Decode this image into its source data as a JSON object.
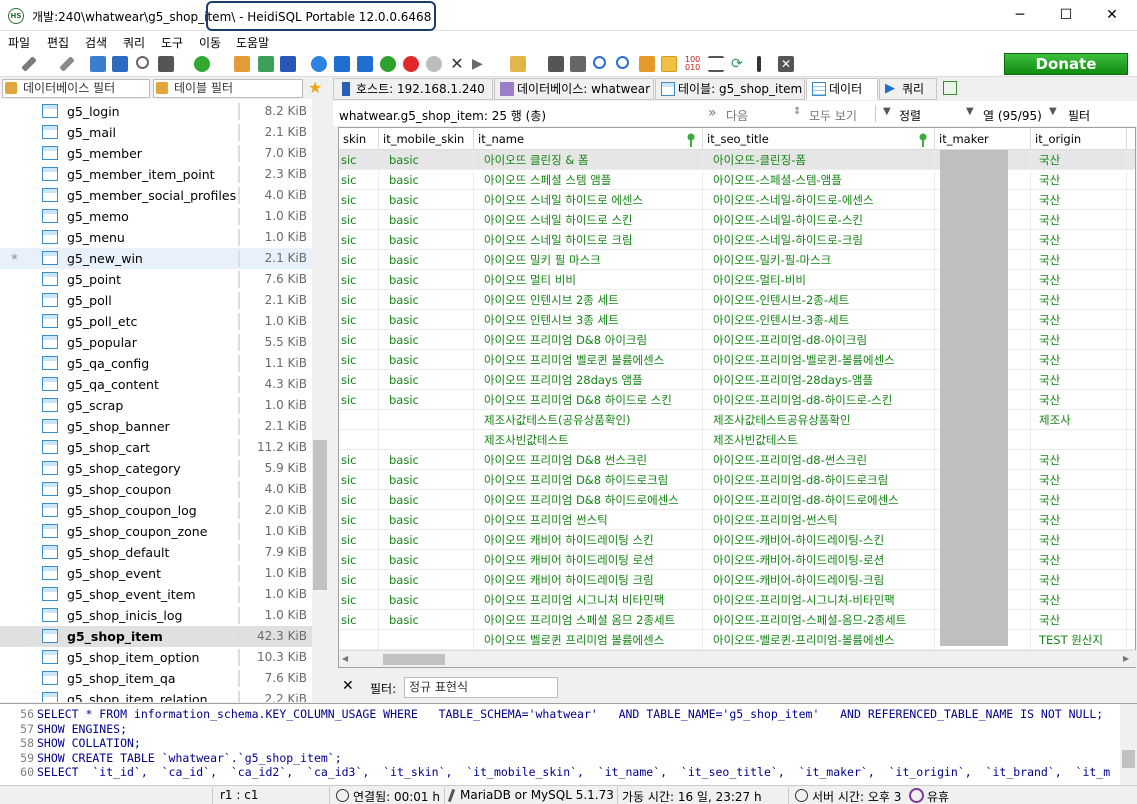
{
  "window": {
    "title": "개발:240\\whatwear\\g5_shop_item\\ - HeidiSQL Portable 12.0.0.6468",
    "icon_text": "HS"
  },
  "menu": [
    "파일",
    "편집",
    "검색",
    "쿼리",
    "도구",
    "이동",
    "도움말"
  ],
  "toolbar": {
    "donate": "Donate"
  },
  "filters": {
    "database_placeholder": "데이터베이스 필터",
    "table_placeholder": "테이블 필터"
  },
  "tree": [
    {
      "name": "g5_login",
      "size": "8.2 KiB"
    },
    {
      "name": "g5_mail",
      "size": "2.1 KiB"
    },
    {
      "name": "g5_member",
      "size": "7.0 KiB"
    },
    {
      "name": "g5_member_item_point",
      "size": "2.3 KiB"
    },
    {
      "name": "g5_member_social_profiles",
      "size": "4.0 KiB"
    },
    {
      "name": "g5_memo",
      "size": "1.0 KiB"
    },
    {
      "name": "g5_menu",
      "size": "1.0 KiB"
    },
    {
      "name": "g5_new_win",
      "size": "2.1 KiB"
    },
    {
      "name": "g5_point",
      "size": "7.6 KiB"
    },
    {
      "name": "g5_poll",
      "size": "2.1 KiB"
    },
    {
      "name": "g5_poll_etc",
      "size": "1.0 KiB"
    },
    {
      "name": "g5_popular",
      "size": "5.5 KiB"
    },
    {
      "name": "g5_qa_config",
      "size": "1.1 KiB"
    },
    {
      "name": "g5_qa_content",
      "size": "4.3 KiB"
    },
    {
      "name": "g5_scrap",
      "size": "1.0 KiB"
    },
    {
      "name": "g5_shop_banner",
      "size": "2.1 KiB"
    },
    {
      "name": "g5_shop_cart",
      "size": "11.2 KiB"
    },
    {
      "name": "g5_shop_category",
      "size": "5.9 KiB"
    },
    {
      "name": "g5_shop_coupon",
      "size": "4.0 KiB"
    },
    {
      "name": "g5_shop_coupon_log",
      "size": "2.0 KiB"
    },
    {
      "name": "g5_shop_coupon_zone",
      "size": "1.0 KiB"
    },
    {
      "name": "g5_shop_default",
      "size": "7.9 KiB"
    },
    {
      "name": "g5_shop_event",
      "size": "1.0 KiB"
    },
    {
      "name": "g5_shop_event_item",
      "size": "1.0 KiB"
    },
    {
      "name": "g5_shop_inicis_log",
      "size": "1.0 KiB"
    },
    {
      "name": "g5_shop_item",
      "size": "42.3 KiB"
    },
    {
      "name": "g5_shop_item_option",
      "size": "10.3 KiB"
    },
    {
      "name": "g5_shop_item_qa",
      "size": "7.6 KiB"
    },
    {
      "name": "g5_shop_item_relation",
      "size": "2.2 KiB"
    }
  ],
  "tabs": {
    "host": "호스트: 192.168.1.240",
    "database": "데이터베이스: whatwear",
    "table": "테이블: g5_shop_item",
    "data": "데이터",
    "query": "쿼리"
  },
  "grid_info": {
    "caption": "whatwear.g5_shop_item: 25 행 (총)",
    "next": "다음",
    "show_all": "모두 보기",
    "sort": "정렬",
    "columns": "열 (95/95)",
    "filter": "필터"
  },
  "columns": [
    "skin",
    "it_mobile_skin",
    "it_name",
    "it_seo_title",
    "it_maker",
    "it_origin"
  ],
  "rows": [
    [
      "sic",
      "basic",
      "아이오뜨 클린징 & 폼",
      "아이오뜨-클린징-폼",
      "",
      "국산"
    ],
    [
      "sic",
      "basic",
      "아이오뜨 스페셜 스템 앰플",
      "아이오뜨-스페셜-스템-앰플",
      "",
      "국산"
    ],
    [
      "sic",
      "basic",
      "아이오뜨 스네일 하이드로 에센스",
      "아이오뜨-스네일-하이드로-에센스",
      "",
      "국산"
    ],
    [
      "sic",
      "basic",
      "아이오뜨 스네일 하이드로 스킨",
      "아이오뜨-스네일-하이드로-스킨",
      "",
      "국산"
    ],
    [
      "sic",
      "basic",
      "아이오뜨 스네일 하이드로 크림",
      "아이오뜨-스네일-하이드로-크림",
      "",
      "국산"
    ],
    [
      "sic",
      "basic",
      "아이오뜨 밀키 필 마스크",
      "아이오뜨-밀키-필-마스크",
      "",
      "국산"
    ],
    [
      "sic",
      "basic",
      "아이오뜨 멀티 비비",
      "아이오뜨-멀티-비비",
      "",
      "국산"
    ],
    [
      "sic",
      "basic",
      "아이오뜨 인텐시브 2종 세트",
      "아이오뜨-인텐시브-2종-세트",
      "",
      "국산"
    ],
    [
      "sic",
      "basic",
      "아이오뜨 인텐시브 3종 세트",
      "아이오뜨-인텐시브-3종-세트",
      "",
      "국산"
    ],
    [
      "sic",
      "basic",
      "아이오뜨 프리미엄 D&8 아이크림",
      "아이오뜨-프리미엄-d8-아이크림",
      "",
      "국산"
    ],
    [
      "sic",
      "basic",
      "아이오뜨 프리미엄 벨로퀸 볼륨에센스",
      "아이오뜨-프리미엄-벨로퀸-볼륨에센스",
      "",
      "국산"
    ],
    [
      "sic",
      "basic",
      "아이오뜨 프리미엄 28days 앰플",
      "아이오뜨-프리미엄-28days-앰플",
      "",
      "국산"
    ],
    [
      "sic",
      "basic",
      "아이오뜨 프리미엄 D&8 하이드로 스킨",
      "아이오뜨-프리미엄-d8-하이드로-스킨",
      "",
      "국산"
    ],
    [
      "",
      "",
      "제조사값테스트(공유상품확인)",
      "제조사값테스트공유상품확인",
      "",
      "제조사"
    ],
    [
      "",
      "",
      "제조사빈값테스트",
      "제조사빈값테스트",
      "",
      ""
    ],
    [
      "sic",
      "basic",
      "아이오뜨 프리미엄 D&8 썬스크린",
      "아이오뜨-프리미엄-d8-썬스크린",
      "",
      "국산"
    ],
    [
      "sic",
      "basic",
      "아이오뜨 프리미엄 D&8 하이드로크림",
      "아이오뜨-프리미엄-d8-하이드로크림",
      "",
      "국산"
    ],
    [
      "sic",
      "basic",
      "아이오뜨 프리미엄 D&8 하이드로에센스",
      "아이오뜨-프리미엄-d8-하이드로에센스",
      "",
      "국산"
    ],
    [
      "sic",
      "basic",
      "아이오뜨 프리미엄 썬스틱",
      "아이오뜨-프리미엄-썬스틱",
      "",
      "국산"
    ],
    [
      "sic",
      "basic",
      "아이오뜨 캐비어 하이드레이팅 스킨",
      "아이오뜨-캐비어-하이드레이팅-스킨",
      "",
      "국산"
    ],
    [
      "sic",
      "basic",
      "아이오뜨 캐비어 하이드레이팅 로션",
      "아이오뜨-캐비어-하이드레이팅-로션",
      "",
      "국산"
    ],
    [
      "sic",
      "basic",
      "아이오뜨 캐비어 하이드레이팅 크림",
      "아이오뜨-캐비어-하이드레이팅-크림",
      "",
      "국산"
    ],
    [
      "sic",
      "basic",
      "아이오뜨 프리미엄 시그니처 비타민팩",
      "아이오뜨-프리미엄-시그니처-비타민팩",
      "",
      "국산"
    ],
    [
      "sic",
      "basic",
      "아이오뜨 프리미엄 스페셜 옴므 2종세트",
      "아이오뜨-프리미엄-스페셜-옴므-2종세트",
      "",
      "국산"
    ],
    [
      "",
      "",
      "아이오뜨 벨로퀸 프리미엄 볼륨에센스",
      "아이오뜨-벨로퀸-프리미엄-볼륨에센스",
      "",
      "TEST 원산지"
    ]
  ],
  "filter_bar": {
    "label": "필터:",
    "placeholder": "정규 표현식"
  },
  "sql_log": [
    {
      "n": "56",
      "text": "SELECT * FROM information_schema.KEY_COLUMN_USAGE WHERE   TABLE_SCHEMA='whatwear'   AND TABLE_NAME='g5_shop_item'   AND REFERENCED_TABLE_NAME IS NOT NULL;"
    },
    {
      "n": "57",
      "text": "SHOW ENGINES;"
    },
    {
      "n": "58",
      "text": "SHOW COLLATION;"
    },
    {
      "n": "59",
      "text": "SHOW CREATE TABLE `whatwear`.`g5_shop_item`;"
    },
    {
      "n": "60",
      "text": "SELECT  `it_id`,  `ca_id`,  `ca_id2`,  `ca_id3`,  `it_skin`,  `it_mobile_skin`,  `it_name`,  `it_seo_title`,  `it_maker`,  `it_origin`,  `it_brand`,  `it_m"
    }
  ],
  "status": {
    "position": "r1 : c1",
    "connected": "연결됨: 00:01 h",
    "server": "MariaDB or MySQL 5.1.73",
    "uptime": "가동 시간: 16 일, 23:27 h",
    "server_time": "서버 시간: 오후 3",
    "idle": "유휴"
  },
  "colors": {
    "green_text": "#148414",
    "donate": "#22a822",
    "highlight_border": "#1b3d6e"
  }
}
